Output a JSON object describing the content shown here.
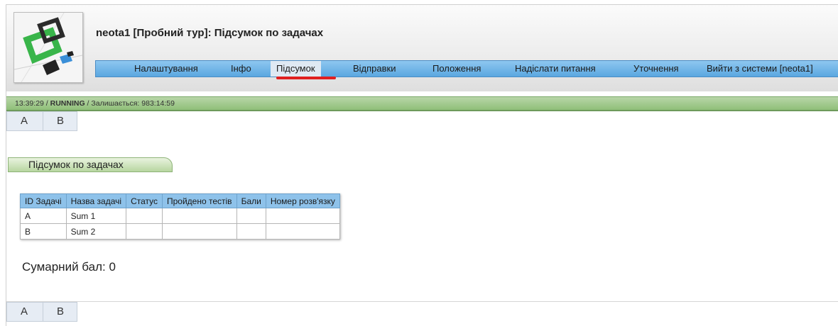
{
  "header": {
    "title": "neota1 [Пробний тур]: Підсумок по задачах",
    "menu": [
      {
        "label": "Налаштування"
      },
      {
        "label": "Інфо"
      },
      {
        "label": "Підсумок"
      },
      {
        "label": "Відправки"
      },
      {
        "label": "Положення"
      },
      {
        "label": "Надіслати питання"
      },
      {
        "label": "Уточнення"
      },
      {
        "label": "Вийти з системи [neota1]"
      }
    ],
    "active_menu_item": "Підсумок"
  },
  "status_bar": {
    "time": "13:39:29",
    "state": "RUNNING",
    "remaining_label": "Залишається:",
    "remaining_value": "983:14:59"
  },
  "problem_tabs": [
    "A",
    "B"
  ],
  "summary": {
    "section_title": "Підсумок по задачах",
    "columns": [
      "ID Задачі",
      "Назва задачі",
      "Статус",
      "Пройдено тестів",
      "Бали",
      "Номер розв'язку"
    ],
    "rows": [
      [
        "A",
        "Sum 1",
        "",
        "",
        "",
        ""
      ],
      [
        "B",
        "Sum 2",
        "",
        "",
        "",
        ""
      ]
    ],
    "total_label": "Сумарний бал:",
    "total_value": "0"
  },
  "colors": {
    "menu_blue": "#5aa7e0",
    "status_green": "#8fbf78",
    "active_underline": "#e02020",
    "table_header": "#8ec2ea"
  },
  "icons": [
    "logo"
  ]
}
